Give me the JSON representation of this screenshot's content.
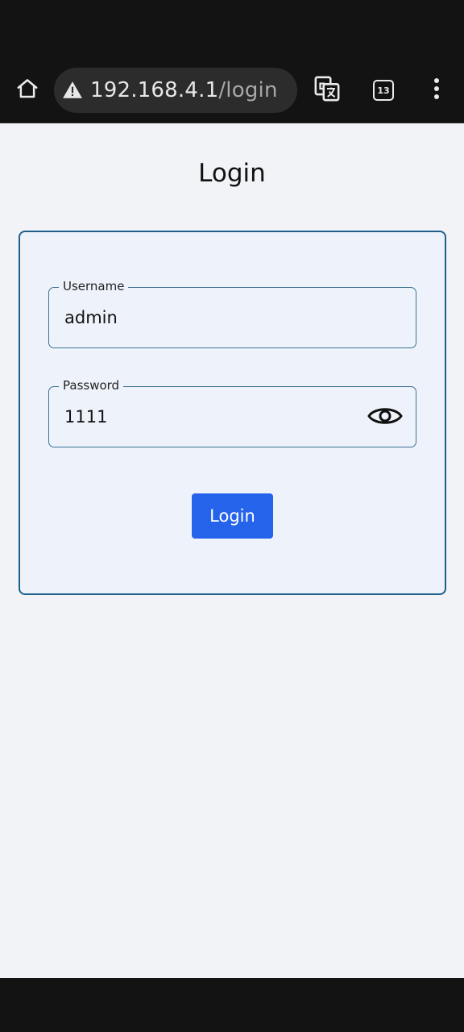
{
  "browser": {
    "url_host": "192.168.4.1",
    "url_path": "/login",
    "tab_count": "13",
    "icons": {
      "home": "home-icon",
      "warning": "warning-icon",
      "translate": "translate-icon",
      "tabs": "tabs-icon",
      "menu": "more-vert-icon"
    }
  },
  "page": {
    "title": "Login",
    "form": {
      "username_label": "Username",
      "username_value": "admin",
      "password_label": "Password",
      "password_value": "1111",
      "submit_label": "Login"
    }
  },
  "colors": {
    "accent": "#2563eb",
    "card_border": "#1f5f8b",
    "card_bg": "#eef3fb",
    "page_bg": "#f1f3f6",
    "chrome_bg": "#131313"
  }
}
